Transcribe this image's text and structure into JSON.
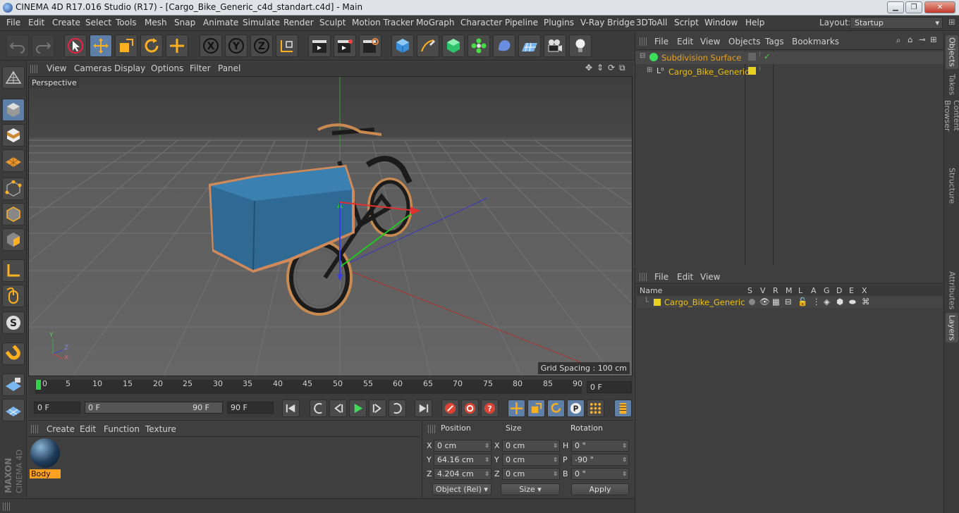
{
  "title": "CINEMA 4D R17.016 Studio (R17) - [Cargo_Bike_Generic_c4d_standart.c4d] - Main",
  "menu": [
    "File",
    "Edit",
    "Create",
    "Select",
    "Tools",
    "Mesh",
    "Snap",
    "Animate",
    "Simulate",
    "Render",
    "Sculpt",
    "Motion Tracker",
    "MoGraph",
    "Character",
    "Pipeline",
    "Plugins",
    "V-Ray Bridge",
    "3DToAll",
    "Script",
    "Window",
    "Help"
  ],
  "layout": {
    "label": "Layout:",
    "value": "Startup"
  },
  "viewport": {
    "menu": [
      "View",
      "Cameras",
      "Display",
      "Options",
      "Filter",
      "Panel"
    ],
    "label": "Perspective",
    "grid_spacing": "Grid Spacing : 100 cm",
    "axis": {
      "x": "X",
      "y": "Y",
      "z": "Z"
    }
  },
  "timeline": {
    "ticks": [
      "0",
      "5",
      "10",
      "15",
      "20",
      "25",
      "30",
      "35",
      "40",
      "45",
      "50",
      "55",
      "60",
      "65",
      "70",
      "75",
      "80",
      "85",
      "90"
    ],
    "frame_field": "0 F"
  },
  "anim": {
    "start": "0 F",
    "range_start": "0 F",
    "range_end": "90 F",
    "end": "90 F"
  },
  "materials": {
    "menu": [
      "Create",
      "Edit",
      "Function",
      "Texture"
    ],
    "items": [
      {
        "name": "Body"
      }
    ]
  },
  "coords": {
    "headers": {
      "position": "Position",
      "size": "Size",
      "rotation": "Rotation"
    },
    "rows": [
      {
        "axis": "X",
        "pos": "0 cm",
        "saxis": "X",
        "size": "0 cm",
        "raxis": "H",
        "rot": "0 °"
      },
      {
        "axis": "Y",
        "pos": "64.16 cm",
        "saxis": "Y",
        "size": "0 cm",
        "raxis": "P",
        "rot": "-90 °"
      },
      {
        "axis": "Z",
        "pos": "4.204 cm",
        "saxis": "Z",
        "size": "0 cm",
        "raxis": "B",
        "rot": "0 °"
      }
    ],
    "mode": "Object (Rel)",
    "size_mode": "Size",
    "apply": "Apply"
  },
  "objects": {
    "menu": [
      "File",
      "Edit",
      "View",
      "Objects",
      "Tags",
      "Bookmarks"
    ],
    "items": [
      {
        "name": "Subdivision Surface",
        "color": "#e6a020"
      },
      {
        "name": "Cargo_Bike_Generic",
        "color": "#f0c000"
      }
    ]
  },
  "layers": {
    "menu": [
      "File",
      "Edit",
      "View"
    ],
    "name_header": "Name",
    "cols": [
      "S",
      "V",
      "R",
      "M",
      "L",
      "A",
      "G",
      "D",
      "E",
      "X"
    ],
    "items": [
      {
        "name": "Cargo_Bike_Generic"
      }
    ]
  },
  "side_tabs": [
    "Objects",
    "Takes",
    "Content Browser",
    "Structure",
    "Attributes",
    "Layers"
  ],
  "colors": {
    "accent": "#5d7fa8",
    "selected": "#e6a020",
    "layer": "#e8d020"
  }
}
